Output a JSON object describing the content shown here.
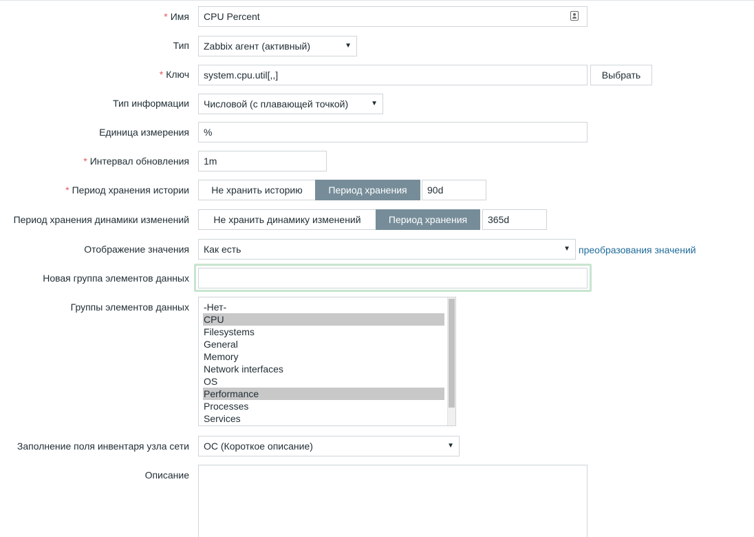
{
  "form": {
    "name": {
      "label": "Имя",
      "value": "CPU Percent",
      "icon": "contact-card-icon"
    },
    "type": {
      "label": "Тип",
      "value": "Zabbix агент (активный)"
    },
    "key": {
      "label": "Ключ",
      "value": "system.cpu.util[,,]",
      "select_button": "Выбрать"
    },
    "info_type": {
      "label": "Тип информации",
      "value": "Числовой (с плавающей точкой)"
    },
    "units": {
      "label": "Единица измерения",
      "value": "%"
    },
    "interval": {
      "label": "Интервал обновления",
      "value": "1m"
    },
    "history": {
      "label": "Период хранения истории",
      "option_off": "Не хранить историю",
      "option_on": "Период хранения",
      "value": "90d"
    },
    "trends": {
      "label": "Период хранения динамики изменений",
      "option_off": "Не хранить динамику изменений",
      "option_on": "Период хранения",
      "value": "365d"
    },
    "valuemap": {
      "label": "Отображение значения",
      "value": "Как есть",
      "link": "преобразования значений"
    },
    "new_app": {
      "label": "Новая группа элементов данных",
      "value": ""
    },
    "applications": {
      "label": "Группы элементов данных",
      "options": [
        {
          "text": "-Нет-",
          "selected": false
        },
        {
          "text": "CPU",
          "selected": true
        },
        {
          "text": "Filesystems",
          "selected": false
        },
        {
          "text": "General",
          "selected": false
        },
        {
          "text": "Memory",
          "selected": false
        },
        {
          "text": "Network interfaces",
          "selected": false
        },
        {
          "text": "OS",
          "selected": false
        },
        {
          "text": "Performance",
          "selected": true
        },
        {
          "text": "Processes",
          "selected": false
        },
        {
          "text": "Services",
          "selected": false
        }
      ]
    },
    "inventory": {
      "label": "Заполнение поля инвентаря узла сети",
      "value": "ОС (Короткое описание)"
    },
    "description": {
      "label": "Описание",
      "value": ""
    }
  },
  "colors": {
    "required_asterisk": "#e45959",
    "active_segment": "#768d99",
    "link": "#1f6b99",
    "focus_ring": "#c7e5cf"
  }
}
